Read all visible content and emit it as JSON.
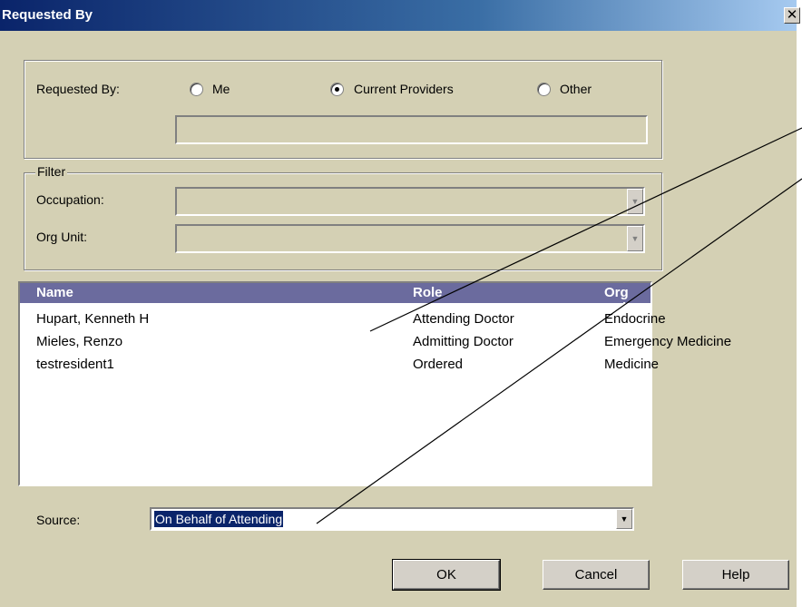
{
  "window": {
    "title": "Requested By",
    "close_glyph": "✕"
  },
  "requested_by": {
    "label": "Requested By:",
    "options": [
      {
        "label": "Me",
        "selected": false
      },
      {
        "label": "Current Providers",
        "selected": true
      },
      {
        "label": "Other",
        "selected": false
      }
    ],
    "other_value": ""
  },
  "filter": {
    "legend": "Filter",
    "occupation_label": "Occupation:",
    "occupation_value": "",
    "org_unit_label": "Org Unit:",
    "org_unit_value": ""
  },
  "provider_list": {
    "columns": [
      "Name",
      "Role",
      "Org Unit"
    ],
    "rows": [
      [
        "Hupart, Kenneth H",
        "Attending Doctor",
        "Endocrine"
      ],
      [
        "Mieles, Renzo",
        "Admitting Doctor",
        "Emergency Medicine"
      ],
      [
        "testresident1",
        "Ordered",
        "Medicine"
      ]
    ]
  },
  "source": {
    "label": "Source:",
    "value": "On Behalf of Attending"
  },
  "buttons": {
    "ok": "OK",
    "cancel": "Cancel",
    "help": "Help"
  },
  "colors": {
    "dialog_bg": "#d4d0b4",
    "title_bar": "#0a246a",
    "list_header": "#6b6b9e",
    "selection": "#0a246a"
  }
}
